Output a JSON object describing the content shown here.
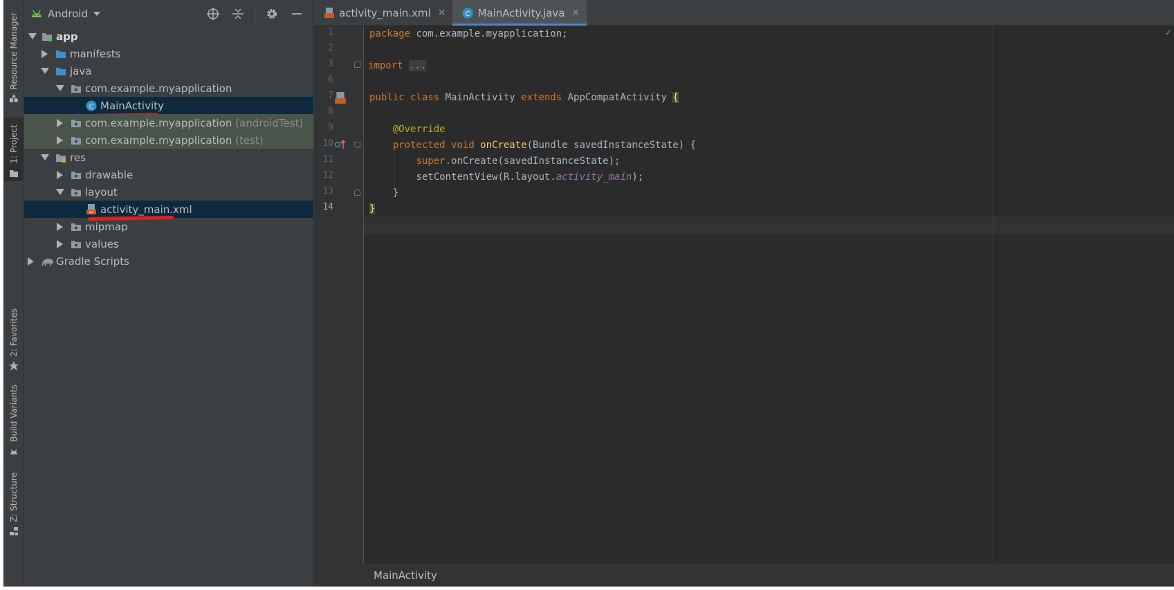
{
  "toolstrip": {
    "resource_manager": "Resource Manager",
    "project": "1: Project",
    "favorites": "2: Favorites",
    "build_variants": "Build Variants",
    "structure": "Z: Structure"
  },
  "project_panel": {
    "view_mode": "Android",
    "tree": {
      "app": "app",
      "manifests": "manifests",
      "java": "java",
      "pkg_main": "com.example.myapplication",
      "main_activity": "MainActivity",
      "pkg_android_test": "com.example.myapplication",
      "android_test_suffix": "(androidTest)",
      "pkg_test": "com.example.myapplication",
      "test_suffix": "(test)",
      "res": "res",
      "drawable": "drawable",
      "layout": "layout",
      "activity_main": "activity_main.xml",
      "mipmap": "mipmap",
      "values": "values",
      "gradle_scripts": "Gradle Scripts"
    }
  },
  "editor": {
    "tabs": [
      {
        "label": "activity_main.xml",
        "active": false
      },
      {
        "label": "MainActivity.java",
        "active": true
      }
    ],
    "line_numbers": [
      "1",
      "2",
      "3",
      "6",
      "7",
      "8",
      "9",
      "10",
      "11",
      "12",
      "13",
      "14"
    ],
    "code": {
      "l1_kw": "package",
      "l1_rest": " com.example.myapplication;",
      "l3_kw": "import",
      "l3_dots": "...",
      "l7_kw1": "public class ",
      "l7_name": "MainActivity ",
      "l7_kw2": "extends ",
      "l7_super": "AppCompatActivity ",
      "l7_brace": "{",
      "l9_ann": "@Override",
      "l10_kw": "protected void ",
      "l10_fn": "onCreate",
      "l10_rest": "(Bundle savedInstanceState) {",
      "l11_kw": "super",
      "l11_rest": ".onCreate(savedInstanceState);",
      "l12_pre": "setContentView(R.layout.",
      "l12_it": "activity_main",
      "l12_post": ");",
      "l13": "}",
      "l14": "}"
    },
    "breadcrumb": "MainActivity"
  },
  "colors": {
    "background": "#2b2b2b",
    "panel": "#3c3f41",
    "selection": "#0d293e",
    "keyword": "#cc7832",
    "annotation": "#bbb529",
    "function": "#ffc66d",
    "field": "#9876aa",
    "underline_annotation": "#e02020"
  }
}
